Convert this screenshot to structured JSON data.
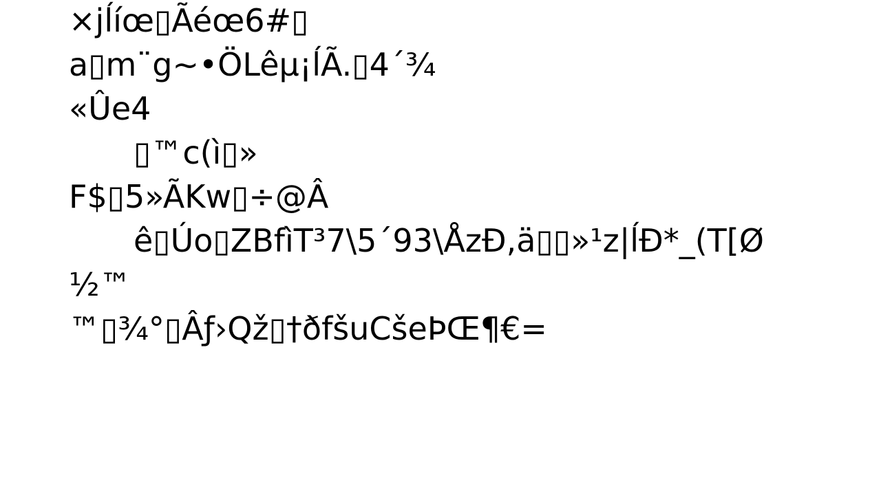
{
  "document": {
    "lines": [
      "/",
      "×jĺíœ▯Ãéœ6#▯",
      "a▯m¨g~•ÖLêµ¡ĺÃ.▯4´¾",
      "«Ûe4",
      "▯™c(ì▯»",
      "F$▯5»ÃKw▯÷@Â",
      "ê▯Úo▯ZBfìT³7\\5´93\\ÅzĐ,ä▯▯»¹z|ĺĐ*_(T[Ø",
      "½™",
      "™▯¾°▯Âƒ›Qž▯†ðfšuCšeÞŒ¶€="
    ]
  }
}
